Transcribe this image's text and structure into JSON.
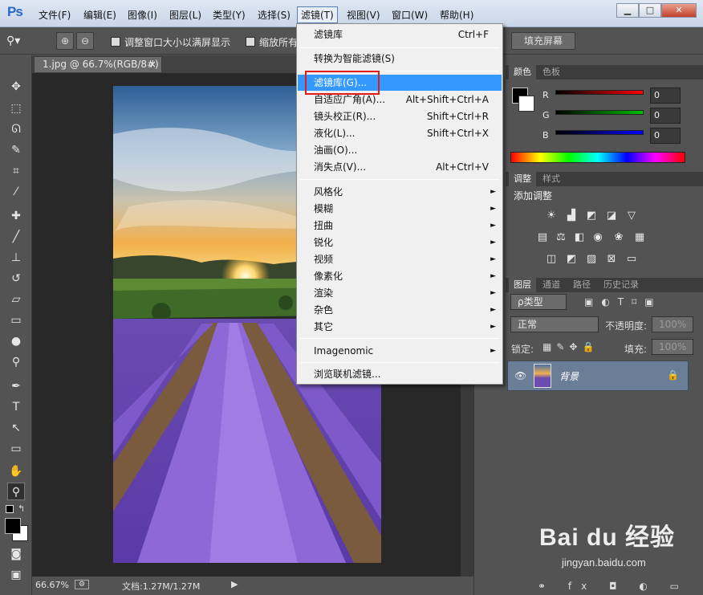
{
  "menubar": {
    "logo": "Ps",
    "items": [
      "文件(F)",
      "编辑(E)",
      "图像(I)",
      "图层(L)",
      "类型(Y)",
      "选择(S)",
      "滤镜(T)",
      "视图(V)",
      "窗口(W)",
      "帮助(H)"
    ],
    "window_buttons": [
      "▁",
      "□",
      "✕"
    ]
  },
  "options": {
    "resize_window_label": "调整窗口大小以满屏显示",
    "zoom_all_label": "缩放所有",
    "fill_screen_button": "填充屏幕"
  },
  "document": {
    "tab_label": "1.jpg @ 66.7%(RGB/8#)",
    "tab_close": "×",
    "zoom_level": "66.67%",
    "doc_size": "文档:1.27M/1.27M"
  },
  "filter_menu": {
    "items": [
      {
        "label": "滤镜库",
        "shortcut": "Ctrl+F"
      },
      {
        "label": "转换为智能滤镜(S)",
        "shortcut": ""
      },
      {
        "label": "滤镜库(G)...",
        "shortcut": ""
      },
      {
        "label": "自适应广角(A)...",
        "shortcut": "Alt+Shift+Ctrl+A"
      },
      {
        "label": "镜头校正(R)...",
        "shortcut": "Shift+Ctrl+R"
      },
      {
        "label": "液化(L)...",
        "shortcut": "Shift+Ctrl+X"
      },
      {
        "label": "油画(O)...",
        "shortcut": ""
      },
      {
        "label": "消失点(V)...",
        "shortcut": "Alt+Ctrl+V"
      },
      {
        "label": "风格化",
        "shortcut": ""
      },
      {
        "label": "模糊",
        "shortcut": ""
      },
      {
        "label": "扭曲",
        "shortcut": ""
      },
      {
        "label": "锐化",
        "shortcut": ""
      },
      {
        "label": "视频",
        "shortcut": ""
      },
      {
        "label": "像素化",
        "shortcut": ""
      },
      {
        "label": "渲染",
        "shortcut": ""
      },
      {
        "label": "杂色",
        "shortcut": ""
      },
      {
        "label": "其它",
        "shortcut": ""
      },
      {
        "label": "Imagenomic",
        "shortcut": ""
      },
      {
        "label": "浏览联机滤镜...",
        "shortcut": ""
      }
    ],
    "submenu_arrow": "►"
  },
  "color_panel": {
    "tabs": [
      "颜色",
      "色板"
    ],
    "channels": [
      {
        "label": "R",
        "value": "0",
        "color": "#ff0000"
      },
      {
        "label": "G",
        "value": "0",
        "color": "#00c000"
      },
      {
        "label": "B",
        "value": "0",
        "color": "#0000ff"
      }
    ]
  },
  "adjust_panel": {
    "tabs": [
      "调整",
      "样式"
    ],
    "heading": "添加调整"
  },
  "layers_panel": {
    "tabs": [
      "图层",
      "通道",
      "路径",
      "历史记录"
    ],
    "kind_filter": "ρ类型",
    "blend_mode": "正常",
    "opacity_label": "不透明度:",
    "opacity_value": "100%",
    "lock_label": "锁定:",
    "fill_label": "填充:",
    "fill_value": "100%",
    "layer_name": "背景"
  },
  "watermark": {
    "logo": "Bai du 经验",
    "url": "jingyan.baidu.com"
  },
  "colors": {
    "highlight": "#3399ff",
    "callout": "#e21b1b",
    "panel": "#535353"
  }
}
